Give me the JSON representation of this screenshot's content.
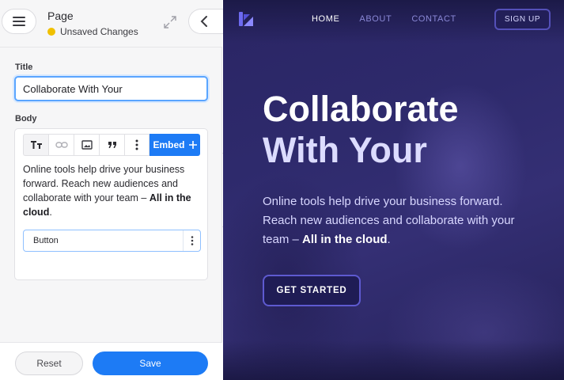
{
  "editor": {
    "header": {
      "title": "Page",
      "status": "Unsaved Changes"
    },
    "title_field": {
      "label": "Title",
      "value": "Collaborate With Your"
    },
    "body_field": {
      "label": "Body",
      "toolbar": {
        "embed_label": "Embed"
      },
      "text_parts": {
        "plain": "Online tools help drive your business forward. Reach new audiences and collaborate with your team – ",
        "bold": "All in the cloud",
        "end": "."
      },
      "button_field_label": "Button"
    },
    "footer": {
      "reset_label": "Reset",
      "save_label": "Save"
    }
  },
  "preview": {
    "nav": {
      "items": [
        "HOME",
        "ABOUT",
        "CONTACT"
      ],
      "signup_label": "SIGN UP"
    },
    "hero": {
      "title_line1": "Collaborate",
      "title_line2": "With Your",
      "subtitle_plain": "Online tools help drive your business forward. Reach new audiences and collaborate with your team – ",
      "subtitle_bold": "All in the cloud",
      "subtitle_end": ".",
      "cta_label": "GET STARTED"
    }
  },
  "colors": {
    "accent_blue": "#1d7bf5",
    "status_yellow": "#f0c000",
    "preview_bg": "#2e2a6c"
  },
  "icons": [
    "menu-icon",
    "expand-icon",
    "chevron-left-icon",
    "text-format-icon",
    "link-icon",
    "image-icon",
    "quote-icon",
    "more-vertical-icon",
    "plus-icon",
    "logo-icon"
  ]
}
